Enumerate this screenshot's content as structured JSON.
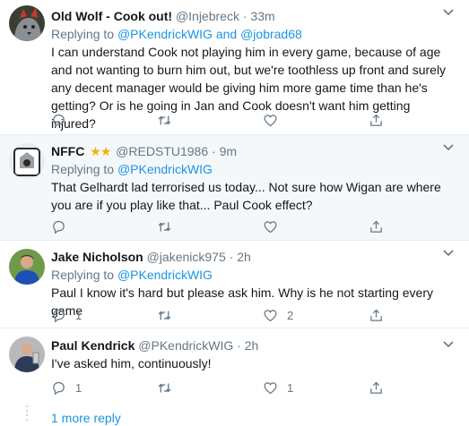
{
  "tweets": [
    {
      "name": "Old Wolf - Cook out!",
      "handle": "@Injebreck",
      "sep": "·",
      "time": "33m",
      "reply_prefix": "Replying to",
      "reply_to_1": "@PKendrickWIG",
      "reply_and": "and",
      "reply_to_2": "@jobrad68",
      "text": "I can understand Cook not playing him in every game, because of age and not wanting to burn him out, but we're toothless up front and surely any decent manager would be giving him more game time than he's getting?  Or is he going in Jan and Cook doesn't want him getting injured?",
      "counts": {
        "reply": "",
        "retweet": "",
        "like": ""
      }
    },
    {
      "name": "NFFC",
      "stars": "★★",
      "handle": "@REDSTU1986",
      "sep": "·",
      "time": "9m",
      "reply_prefix": "Replying to",
      "reply_to_1": "@PKendrickWIG",
      "text": "That Gelhardt lad terrorised us today... Not sure how Wigan are where you are if you play like that... Paul Cook effect?",
      "counts": {
        "reply": "",
        "retweet": "",
        "like": ""
      }
    },
    {
      "name": "Jake Nicholson",
      "handle": "@jakenick975",
      "sep": "·",
      "time": "2h",
      "reply_prefix": "Replying to",
      "reply_to_1": "@PKendrickWIG",
      "text": "Paul I know it's hard but please ask him. Why is he not starting every game",
      "counts": {
        "reply": "1",
        "retweet": "",
        "like": "2"
      }
    },
    {
      "name": "Paul Kendrick",
      "handle": "@PKendrickWIG",
      "sep": "·",
      "time": "2h",
      "text": "I've asked him, continuously!",
      "counts": {
        "reply": "1",
        "retweet": "",
        "like": "1"
      }
    }
  ],
  "more_replies": "1 more reply",
  "icons": [
    "chevron-down-icon",
    "reply-icon",
    "retweet-icon",
    "like-icon",
    "share-icon"
  ],
  "colors": {
    "link": "#1b95e0",
    "secondary": "#657786",
    "highlight_bg": "#f5f8fa",
    "star": "#f0b400"
  }
}
